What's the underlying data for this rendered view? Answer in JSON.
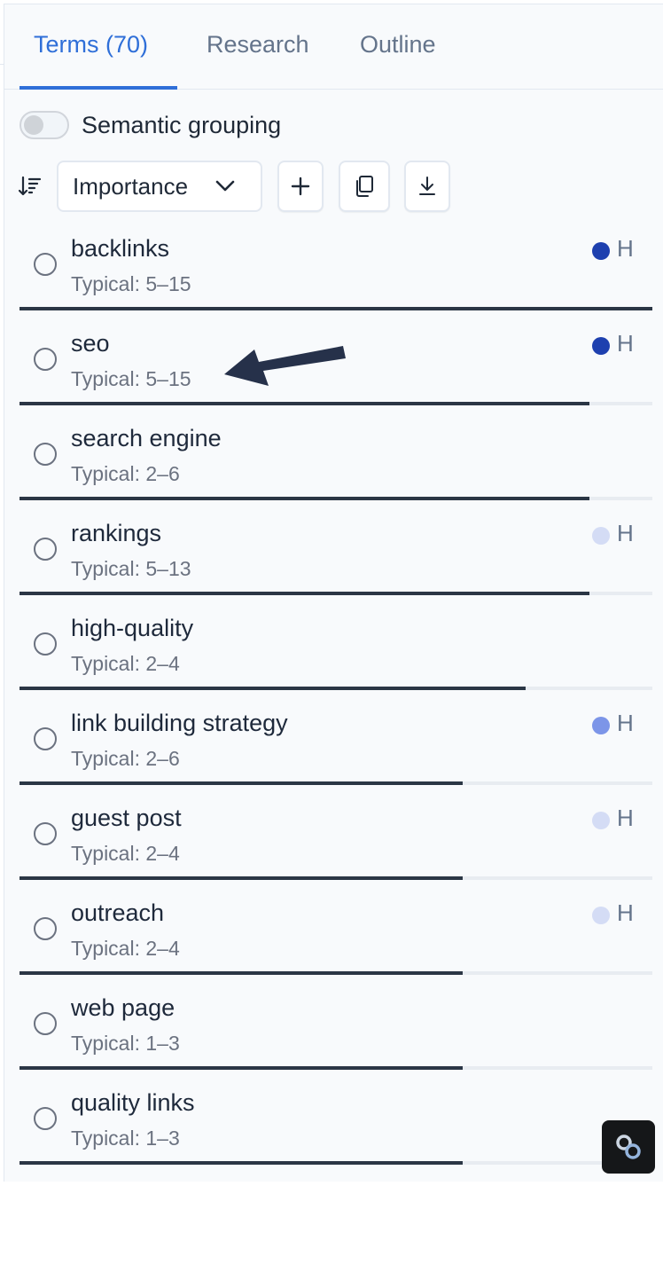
{
  "tabs": [
    {
      "label": "Terms (70)",
      "active": true
    },
    {
      "label": "Research",
      "active": false
    },
    {
      "label": "Outline",
      "active": false
    }
  ],
  "semantic_grouping": {
    "label": "Semantic grouping",
    "enabled": false
  },
  "toolbar": {
    "sort_icon": "sort-descending-icon",
    "sort_select": {
      "value": "Importance"
    },
    "add_icon": "plus-icon",
    "copy_icon": "copy-icon",
    "download_icon": "download-icon"
  },
  "colors": {
    "accent": "#2f6fd8",
    "heading_dark": "#1e40af",
    "heading_medium": "#7c95e8",
    "heading_light": "#d4dcf5",
    "bar": "#2b3645"
  },
  "terms": [
    {
      "name": "backlinks",
      "typical": "Typical: 5–15",
      "heading": "H",
      "heading_level": "dark",
      "usage_fraction": 1.0
    },
    {
      "name": "seo",
      "typical": "Typical: 5–15",
      "heading": "H",
      "heading_level": "dark",
      "usage_fraction": 0.9
    },
    {
      "name": "search engine",
      "typical": "Typical: 2–6",
      "heading": "",
      "heading_level": "none",
      "usage_fraction": 0.9
    },
    {
      "name": "rankings",
      "typical": "Typical: 5–13",
      "heading": "H",
      "heading_level": "light",
      "usage_fraction": 0.9
    },
    {
      "name": "high-quality",
      "typical": "Typical: 2–4",
      "heading": "",
      "heading_level": "none",
      "usage_fraction": 0.8
    },
    {
      "name": "link building strategy",
      "typical": "Typical: 2–6",
      "heading": "H",
      "heading_level": "medium",
      "usage_fraction": 0.7
    },
    {
      "name": "guest post",
      "typical": "Typical: 2–4",
      "heading": "H",
      "heading_level": "light",
      "usage_fraction": 0.7
    },
    {
      "name": "outreach",
      "typical": "Typical: 2–4",
      "heading": "H",
      "heading_level": "light",
      "usage_fraction": 0.7
    },
    {
      "name": "web page",
      "typical": "Typical: 1–3",
      "heading": "",
      "heading_level": "none",
      "usage_fraction": 0.7
    },
    {
      "name": "quality links",
      "typical": "Typical: 1–3",
      "heading": "",
      "heading_level": "none",
      "usage_fraction": 0.7
    }
  ],
  "floating_button": {
    "icon": "link-icon"
  }
}
